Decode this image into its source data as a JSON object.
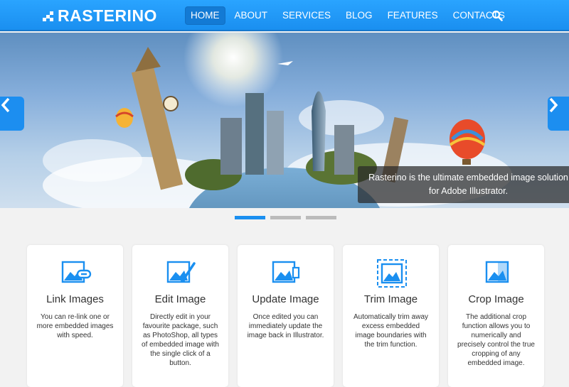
{
  "brand": {
    "name": "RASTERINO"
  },
  "nav": {
    "items": [
      {
        "label": "HOME"
      },
      {
        "label": "ABOUT"
      },
      {
        "label": "SERVICES"
      },
      {
        "label": "BLOG"
      },
      {
        "label": "FEATURES"
      },
      {
        "label": "CONTACTS"
      }
    ]
  },
  "hero": {
    "caption": "Rasterino is the ultimate embedded image solution for Adobe Illustrator."
  },
  "slider": {
    "slide_count": 3,
    "active_slide": 1
  },
  "cards": [
    {
      "title": "Link Images",
      "description": "You can re-link one or more embedded images with speed.",
      "icon": "link-image-icon"
    },
    {
      "title": "Edit Image",
      "description": "Directly edit in your favourite package, such as PhotoShop, all types of embedded image with the single click of a button.",
      "icon": "edit-image-icon"
    },
    {
      "title": "Update Image",
      "description": "Once edited you can immediately update the image back in Illustrator.",
      "icon": "update-image-icon"
    },
    {
      "title": "Trim Image",
      "description": "Automatically trim away excess embedded image boundaries with the trim function.",
      "icon": "trim-image-icon"
    },
    {
      "title": "Crop Image",
      "description": "The additional crop function allows you to numerically and precisely control the true cropping of any embedded image.",
      "icon": "crop-image-icon"
    }
  ],
  "colors": {
    "accent": "#1a8ff0",
    "header": "#2aa4ff",
    "caption_bg": "#282828"
  }
}
